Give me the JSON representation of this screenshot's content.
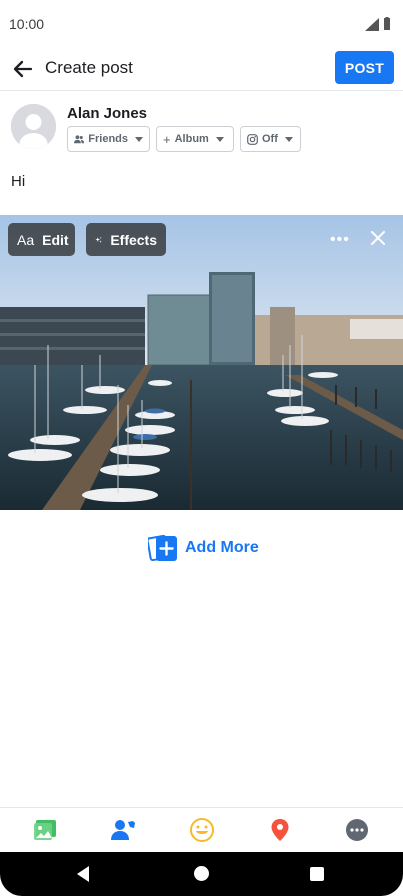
{
  "status": {
    "time": "10:00"
  },
  "header": {
    "title": "Create post",
    "post_label": "POST"
  },
  "user": {
    "name": "Alan Jones"
  },
  "privacy_chips": [
    {
      "label": "Friends",
      "icon": "friends-icon"
    },
    {
      "label": "Album",
      "icon": "plus-icon"
    },
    {
      "label": "Off",
      "icon": "instagram-icon"
    }
  ],
  "post": {
    "text": "Hi"
  },
  "photo": {
    "edit_label": "Edit",
    "edit_icon_text": "Aa",
    "effects_label": "Effects",
    "more_label": "•••"
  },
  "add_more": {
    "label": "Add More"
  },
  "bottom_bar": {
    "items": [
      {
        "icon": "photo-icon",
        "color": "#45bd62"
      },
      {
        "icon": "tag-people-icon",
        "color": "#1877f2"
      },
      {
        "icon": "feeling-icon",
        "color": "#f7b928"
      },
      {
        "icon": "location-icon",
        "color": "#f5533d"
      },
      {
        "icon": "more-icon",
        "color": "#606770"
      }
    ]
  },
  "colors": {
    "accent": "#1877f2"
  }
}
